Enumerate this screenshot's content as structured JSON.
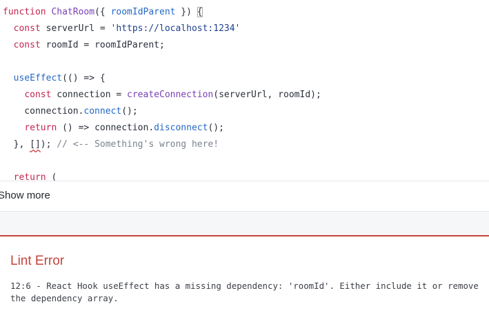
{
  "code": {
    "lines": [
      [
        {
          "t": "function",
          "c": "kw"
        },
        {
          "t": " ",
          "c": "pl"
        },
        {
          "t": "ChatRoom",
          "c": "fn"
        },
        {
          "t": "({ ",
          "c": "pl"
        },
        {
          "t": "roomIdParent",
          "c": "param"
        },
        {
          "t": " }) ",
          "c": "pl"
        },
        {
          "t": "{",
          "c": "pl",
          "box": true
        }
      ],
      [
        {
          "t": "  ",
          "c": "pl"
        },
        {
          "t": "const",
          "c": "kw"
        },
        {
          "t": " serverUrl = ",
          "c": "pl"
        },
        {
          "t": "'https://localhost:1234'",
          "c": "str"
        }
      ],
      [
        {
          "t": "  ",
          "c": "pl"
        },
        {
          "t": "const",
          "c": "kw"
        },
        {
          "t": " roomId = roomIdParent;",
          "c": "pl"
        }
      ],
      [],
      [
        {
          "t": "  ",
          "c": "pl"
        },
        {
          "t": "useEffect",
          "c": "param"
        },
        {
          "t": "(() => {",
          "c": "pl"
        }
      ],
      [
        {
          "t": "    ",
          "c": "pl"
        },
        {
          "t": "const",
          "c": "kw"
        },
        {
          "t": " connection = ",
          "c": "pl"
        },
        {
          "t": "createConnection",
          "c": "fn"
        },
        {
          "t": "(serverUrl, roomId);",
          "c": "pl"
        }
      ],
      [
        {
          "t": "    connection.",
          "c": "pl"
        },
        {
          "t": "connect",
          "c": "param"
        },
        {
          "t": "();",
          "c": "pl"
        }
      ],
      [
        {
          "t": "    ",
          "c": "pl"
        },
        {
          "t": "return",
          "c": "kw"
        },
        {
          "t": " () => connection.",
          "c": "pl"
        },
        {
          "t": "disconnect",
          "c": "param"
        },
        {
          "t": "();",
          "c": "pl"
        }
      ],
      [
        {
          "t": "  }, ",
          "c": "pl"
        },
        {
          "t": "[]",
          "c": "pl",
          "squiggle": true
        },
        {
          "t": "); ",
          "c": "pl"
        },
        {
          "t": "// <-- Something's wrong here!",
          "c": "cm"
        }
      ],
      [],
      [
        {
          "t": "  ",
          "c": "pl"
        },
        {
          "t": "return",
          "c": "kw"
        },
        {
          "t": " (",
          "c": "pl"
        }
      ]
    ]
  },
  "show_more": {
    "label": "Show more"
  },
  "lint": {
    "title": "Lint Error",
    "message": "12:6 - React Hook useEffect has a missing dependency: 'roomId'. Either include it or remove the dependency array."
  }
}
